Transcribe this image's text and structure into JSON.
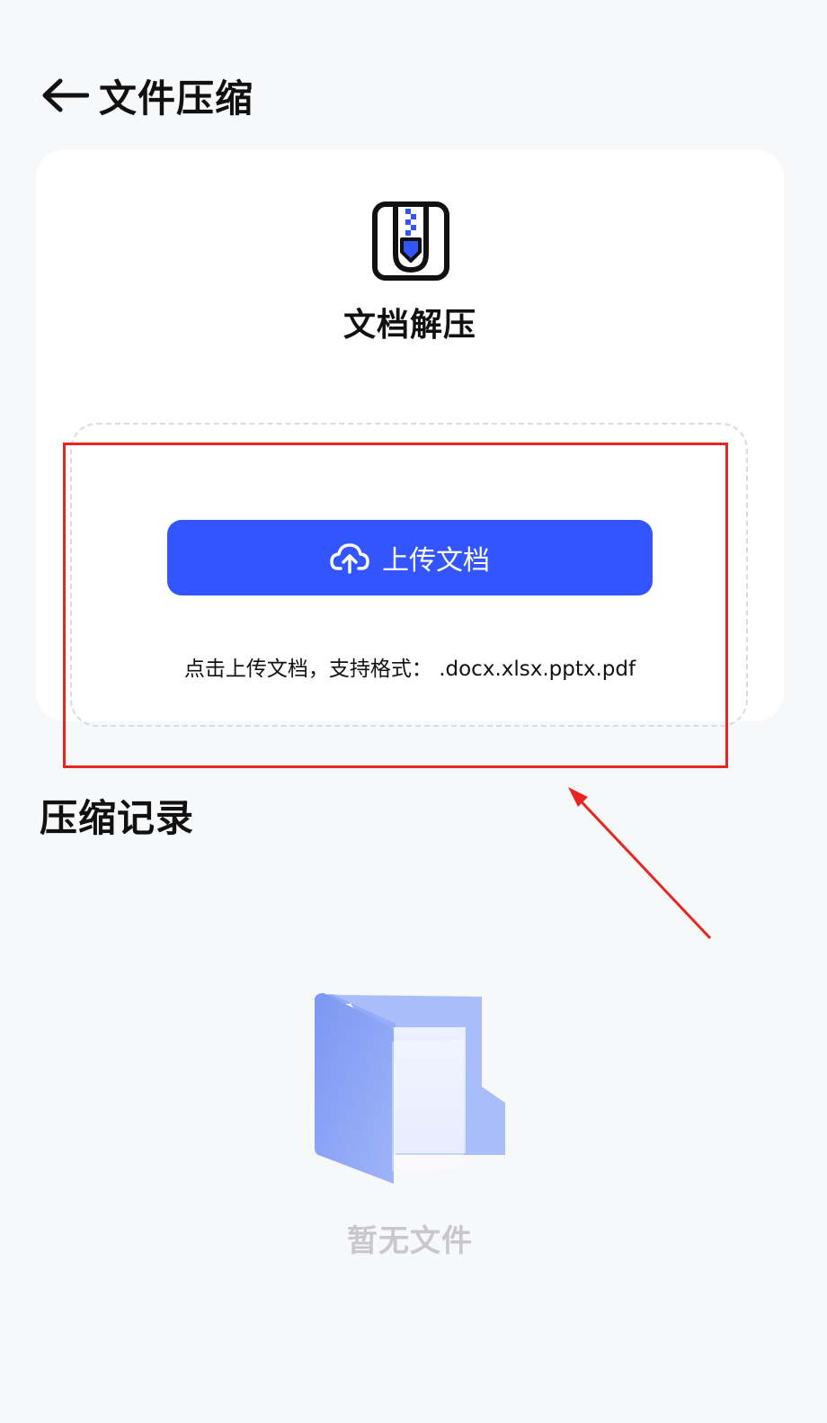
{
  "header": {
    "back_icon": "arrow-left-icon",
    "title": "文件压缩"
  },
  "tool": {
    "icon": "zip-file-icon",
    "title": "文档解压"
  },
  "upload": {
    "button_icon": "cloud-upload-icon",
    "button_label": "上传文档",
    "hint": "点击上传文档，支持格式： .docx.xlsx.pptx.pdf"
  },
  "records": {
    "title": "压缩记录",
    "empty_icon": "empty-folder-icon",
    "empty_text": "暂无文件"
  },
  "colors": {
    "accent": "#3355ff",
    "annotation": "#e8261f",
    "background": "#f7f8fa",
    "card": "#ffffff",
    "empty_text": "#c8c8cc"
  }
}
